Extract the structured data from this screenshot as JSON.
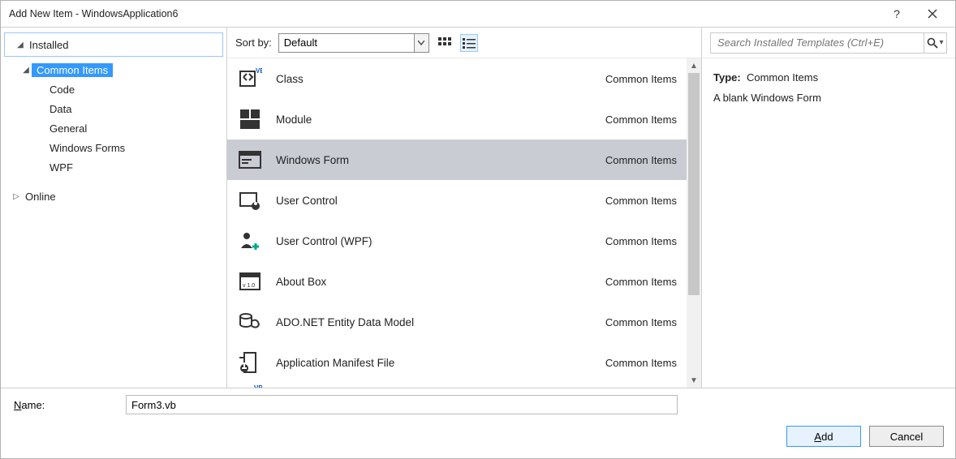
{
  "window": {
    "title": "Add New Item - WindowsApplication6"
  },
  "sidebar": {
    "root": "Installed",
    "group": "Common Items",
    "group_children": [
      "Code",
      "Data",
      "General",
      "Windows Forms",
      "WPF"
    ],
    "other": "Online"
  },
  "toolbar": {
    "sort_label": "Sort by:",
    "sort_value": "Default"
  },
  "search": {
    "placeholder": "Search Installed Templates (Ctrl+E)"
  },
  "items": [
    {
      "name": "Class",
      "cat": "Common Items",
      "icon": "class"
    },
    {
      "name": "Module",
      "cat": "Common Items",
      "icon": "module"
    },
    {
      "name": "Windows Form",
      "cat": "Common Items",
      "icon": "form",
      "selected": true
    },
    {
      "name": "User Control",
      "cat": "Common Items",
      "icon": "usercontrol"
    },
    {
      "name": "User Control (WPF)",
      "cat": "Common Items",
      "icon": "usercontrolwpf"
    },
    {
      "name": "About Box",
      "cat": "Common Items",
      "icon": "aboutbox"
    },
    {
      "name": "ADO.NET Entity Data Model",
      "cat": "Common Items",
      "icon": "ado"
    },
    {
      "name": "Application Manifest File",
      "cat": "Common Items",
      "icon": "manifest"
    }
  ],
  "detail": {
    "type_label": "Type:",
    "type_value": "Common Items",
    "description": "A blank Windows Form"
  },
  "name_field": {
    "label_prefix": "N",
    "label_rest": "ame:",
    "value": "Form3.vb"
  },
  "buttons": {
    "add_u": "A",
    "add_rest": "dd",
    "cancel": "Cancel"
  }
}
